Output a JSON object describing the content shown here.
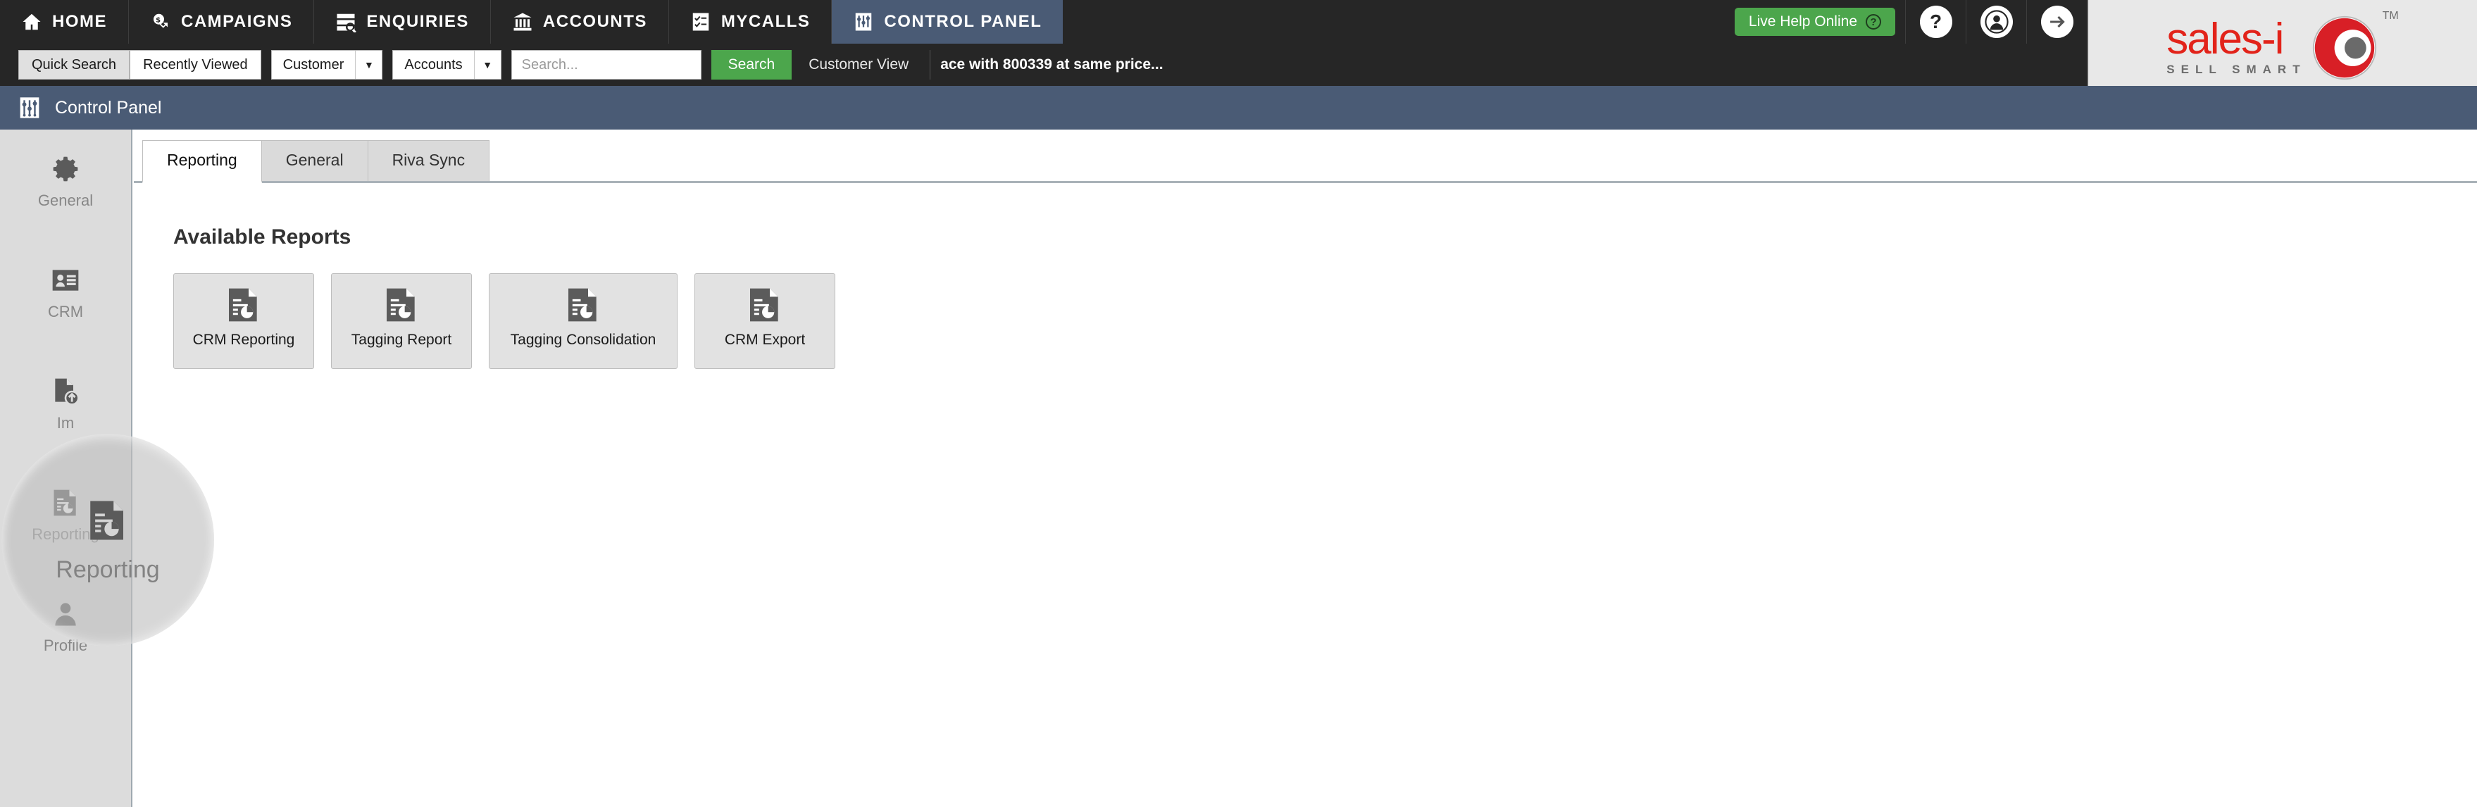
{
  "topnav": {
    "items": [
      {
        "label": "HOME",
        "icon": "home-icon",
        "active": false
      },
      {
        "label": "CAMPAIGNS",
        "icon": "campaigns-icon",
        "active": false
      },
      {
        "label": "ENQUIRIES",
        "icon": "enquiries-icon",
        "active": false
      },
      {
        "label": "ACCOUNTS",
        "icon": "accounts-icon",
        "active": false
      },
      {
        "label": "MYCALLS",
        "icon": "mycalls-icon",
        "active": false
      },
      {
        "label": "CONTROL PANEL",
        "icon": "control-panel-icon",
        "active": true
      }
    ],
    "live_help": "Live Help Online",
    "help_glyph": "?",
    "profile_glyph": "●",
    "logout_glyph": "→"
  },
  "logo": {
    "word": "sales-i",
    "tagline": "SELL SMART",
    "tm": "TM"
  },
  "searchbar": {
    "quick_search": "Quick Search",
    "recently_viewed": "Recently Viewed",
    "customer_dropdown": "Customer",
    "accounts_dropdown": "Accounts",
    "search_placeholder": "Search...",
    "search_value": "",
    "search_button": "Search",
    "customer_view": "Customer View",
    "ticker": "ace with 800339 at same price..."
  },
  "page": {
    "title": "Control Panel"
  },
  "sidebar": {
    "items": [
      {
        "label": "General",
        "icon": "gear-icon"
      },
      {
        "label": "CRM",
        "icon": "crm-card-icon"
      },
      {
        "label": "Im",
        "icon": "import-icon"
      },
      {
        "label": "Reporting",
        "icon": "report-document-icon"
      },
      {
        "label": "Profile",
        "icon": "person-icon"
      }
    ]
  },
  "tabs": [
    {
      "label": "Reporting",
      "active": true
    },
    {
      "label": "General",
      "active": false
    },
    {
      "label": "Riva Sync",
      "active": false
    }
  ],
  "main": {
    "section_title": "Available Reports",
    "reports": [
      {
        "label": "CRM Reporting",
        "icon": "report-document-icon",
        "wide": false
      },
      {
        "label": "Tagging Report",
        "icon": "report-document-icon",
        "wide": false
      },
      {
        "label": "Tagging Consolidation",
        "icon": "report-document-icon",
        "wide": true
      },
      {
        "label": "CRM Export",
        "icon": "report-document-icon",
        "wide": false
      }
    ]
  },
  "lens": {
    "label": "Reporting",
    "icon": "report-document-icon"
  },
  "colors": {
    "nav_bg": "#262626",
    "accent_blue": "#4a5b75",
    "accent_green": "#4ca64c",
    "brand_red": "#e2231a",
    "sidebar_bg": "#dcdcdc"
  }
}
